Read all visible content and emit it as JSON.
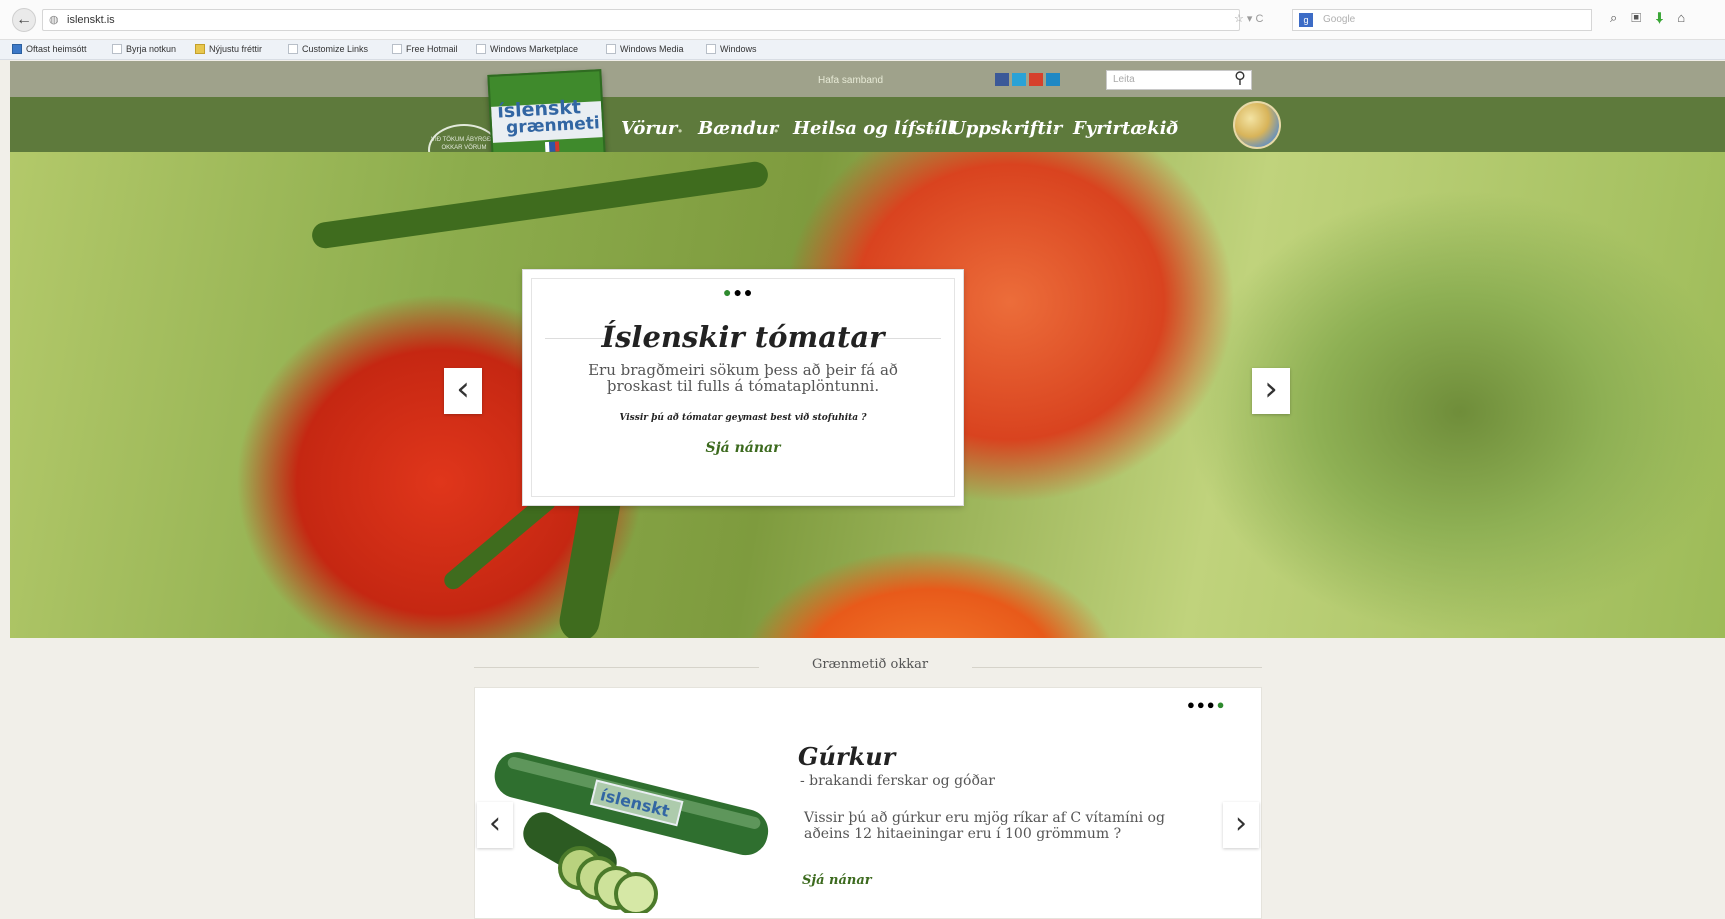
{
  "browser": {
    "url": "islenskt.is",
    "google_placeholder": "Google",
    "bookmarks": [
      "Oftast heimsótt",
      "Byrja notkun",
      "Nýjustu fréttir",
      "Customize Links",
      "Free Hotmail",
      "Windows Marketplace",
      "Windows Media",
      "Windows"
    ]
  },
  "header": {
    "contact_label": "Hafa samband",
    "search_placeholder": "Leita",
    "logo_line1": "íslenskt",
    "logo_line2": "grænmeti",
    "seal_text": "VIÐ TÖKUM ÁBYRGÐ Á OKKAR VÖRUM",
    "nav": [
      "Vörur",
      "Bændur",
      "Heilsa og lífstíll",
      "Uppskriftir",
      "Fyrirtækið"
    ]
  },
  "hero": {
    "dots": "●●●",
    "title": "Íslenskir tómatar",
    "description": "Eru bragðmeiri sökum þess að þeir fá að þroskast til fulls á tómataplöntunni.",
    "question": "Vissir þú að tómatar geymast best við stofuhita ?",
    "more_link": "Sjá nánar",
    "prev": "‹",
    "next": "›"
  },
  "products": {
    "section_title": "Grænmetið okkar",
    "dots": "●●●●",
    "title": "Gúrkur",
    "subtitle": "- brakandi ferskar og góðar",
    "description": "Vissir þú að gúrkur eru mjög ríkar af C vítamíni og aðeins 12 hitaeiningar eru í 100 grömmum ?",
    "more_link": "Sjá nánar",
    "prev": "‹",
    "next": "›",
    "package_label": "íslenskt"
  },
  "colors": {
    "nav_green": "#5e7a3c",
    "topstrip": "#9fa28b",
    "link_green": "#3c6a1e",
    "dot_active": "#2f8b2f",
    "dot_inactive": "#1f1f1f"
  }
}
